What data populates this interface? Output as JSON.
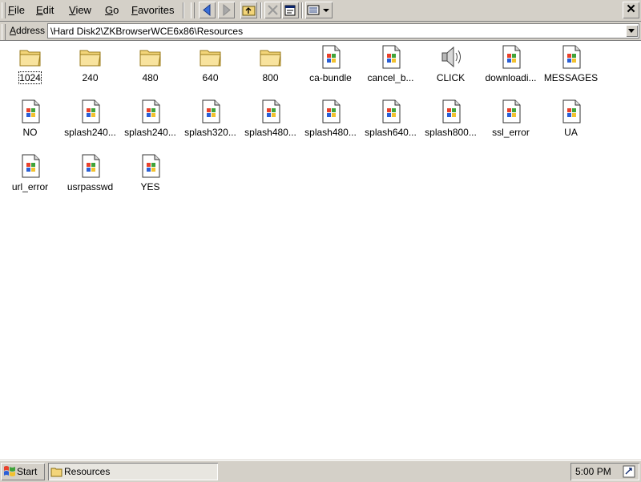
{
  "menu": {
    "items": [
      {
        "label": "File",
        "key": "F",
        "rest": "ile"
      },
      {
        "label": "Edit",
        "key": "E",
        "rest": "dit"
      },
      {
        "label": "View",
        "key": "V",
        "rest": "iew"
      },
      {
        "label": "Go",
        "key": "G",
        "rest": "o"
      },
      {
        "label": "Favorites",
        "key": "F",
        "rest": "avorites"
      }
    ]
  },
  "toolbar": {
    "buttons": [
      "back-icon",
      "forward-icon",
      "up-folder-icon",
      "delete-icon",
      "properties-icon",
      "views-icon"
    ],
    "close_label": "✕"
  },
  "address": {
    "label_key": "A",
    "label_rest": "ddress",
    "value": "\\Hard Disk2\\ZKBrowserWCE6x86\\Resources"
  },
  "files": [
    {
      "name": "1024",
      "type": "folder"
    },
    {
      "name": "240",
      "type": "folder"
    },
    {
      "name": "480",
      "type": "folder"
    },
    {
      "name": "640",
      "type": "folder"
    },
    {
      "name": "800",
      "type": "folder"
    },
    {
      "name": "ca-bundle",
      "type": "file"
    },
    {
      "name": "cancel_b...",
      "type": "file"
    },
    {
      "name": "CLICK",
      "type": "sound"
    },
    {
      "name": "downloadi...",
      "type": "file"
    },
    {
      "name": "MESSAGES",
      "type": "file"
    },
    {
      "name": "NO",
      "type": "file"
    },
    {
      "name": "splash240...",
      "type": "file"
    },
    {
      "name": "splash240...",
      "type": "file"
    },
    {
      "name": "splash320...",
      "type": "file"
    },
    {
      "name": "splash480...",
      "type": "file"
    },
    {
      "name": "splash480...",
      "type": "file"
    },
    {
      "name": "splash640...",
      "type": "file"
    },
    {
      "name": "splash800...",
      "type": "file"
    },
    {
      "name": "ssl_error",
      "type": "file"
    },
    {
      "name": "UA",
      "type": "file"
    },
    {
      "name": "url_error",
      "type": "file"
    },
    {
      "name": "usrpasswd",
      "type": "file"
    },
    {
      "name": "YES",
      "type": "file"
    }
  ],
  "taskbar": {
    "start_label": "Start",
    "task_label": "Resources",
    "clock": "5:00 PM"
  },
  "colors": {
    "chrome": "#d4d0c8",
    "folder": "#f3d57a",
    "window_bg": "#ffffff"
  }
}
